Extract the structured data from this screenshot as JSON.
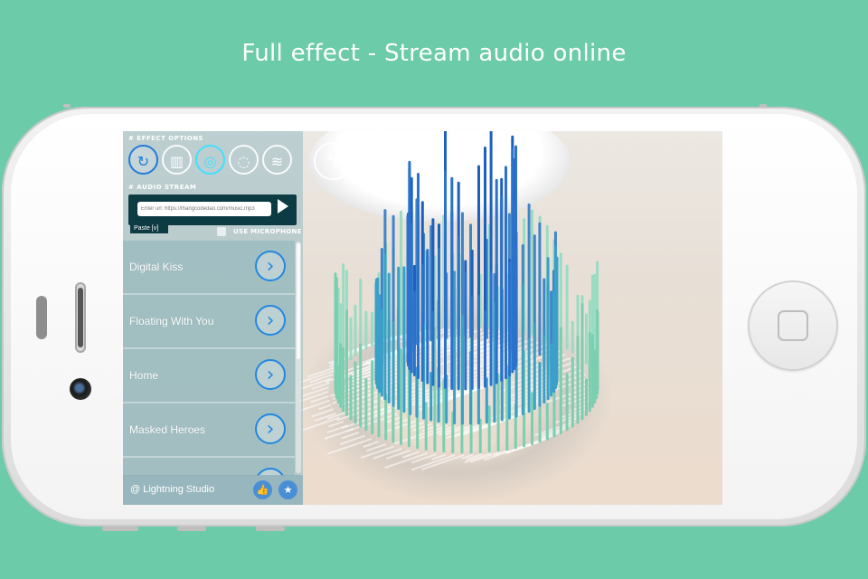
{
  "headline": "Full effect - Stream audio online",
  "sidebar": {
    "effect_options_title": "# EFFECT OPTIONS",
    "effects": [
      {
        "icon": "refresh-icon",
        "glyph": "↻"
      },
      {
        "icon": "equalizer-icon",
        "glyph": "▥"
      },
      {
        "icon": "target-icon",
        "glyph": "◎"
      },
      {
        "icon": "dotted-circle-icon",
        "glyph": "◌"
      },
      {
        "icon": "waveform-icon",
        "glyph": "≋"
      }
    ],
    "audio_stream_title": "# AUDIO STREAM",
    "url_placeholder": "Enter url: https://thangcodedao.com/music.mp3",
    "paste_label": "Paste [v]",
    "use_microphone_label": "USE MICROPHONE",
    "tracks": [
      {
        "name": "Digital Kiss"
      },
      {
        "name": "Floating With You"
      },
      {
        "name": "Home"
      },
      {
        "name": "Masked Heroes"
      },
      {
        "name": ""
      }
    ],
    "footer_text": "@ Lightning Studio",
    "footer_icons": [
      "thumbs-up-icon",
      "star-icon"
    ]
  },
  "overlay": {
    "bolt_icon": "lightning-bolt-icon"
  },
  "colors": {
    "background": "#6ccba9",
    "accent_blue": "#2288e0",
    "bar_dark": "#1f5fbf",
    "bar_light": "#8fd6b9"
  }
}
